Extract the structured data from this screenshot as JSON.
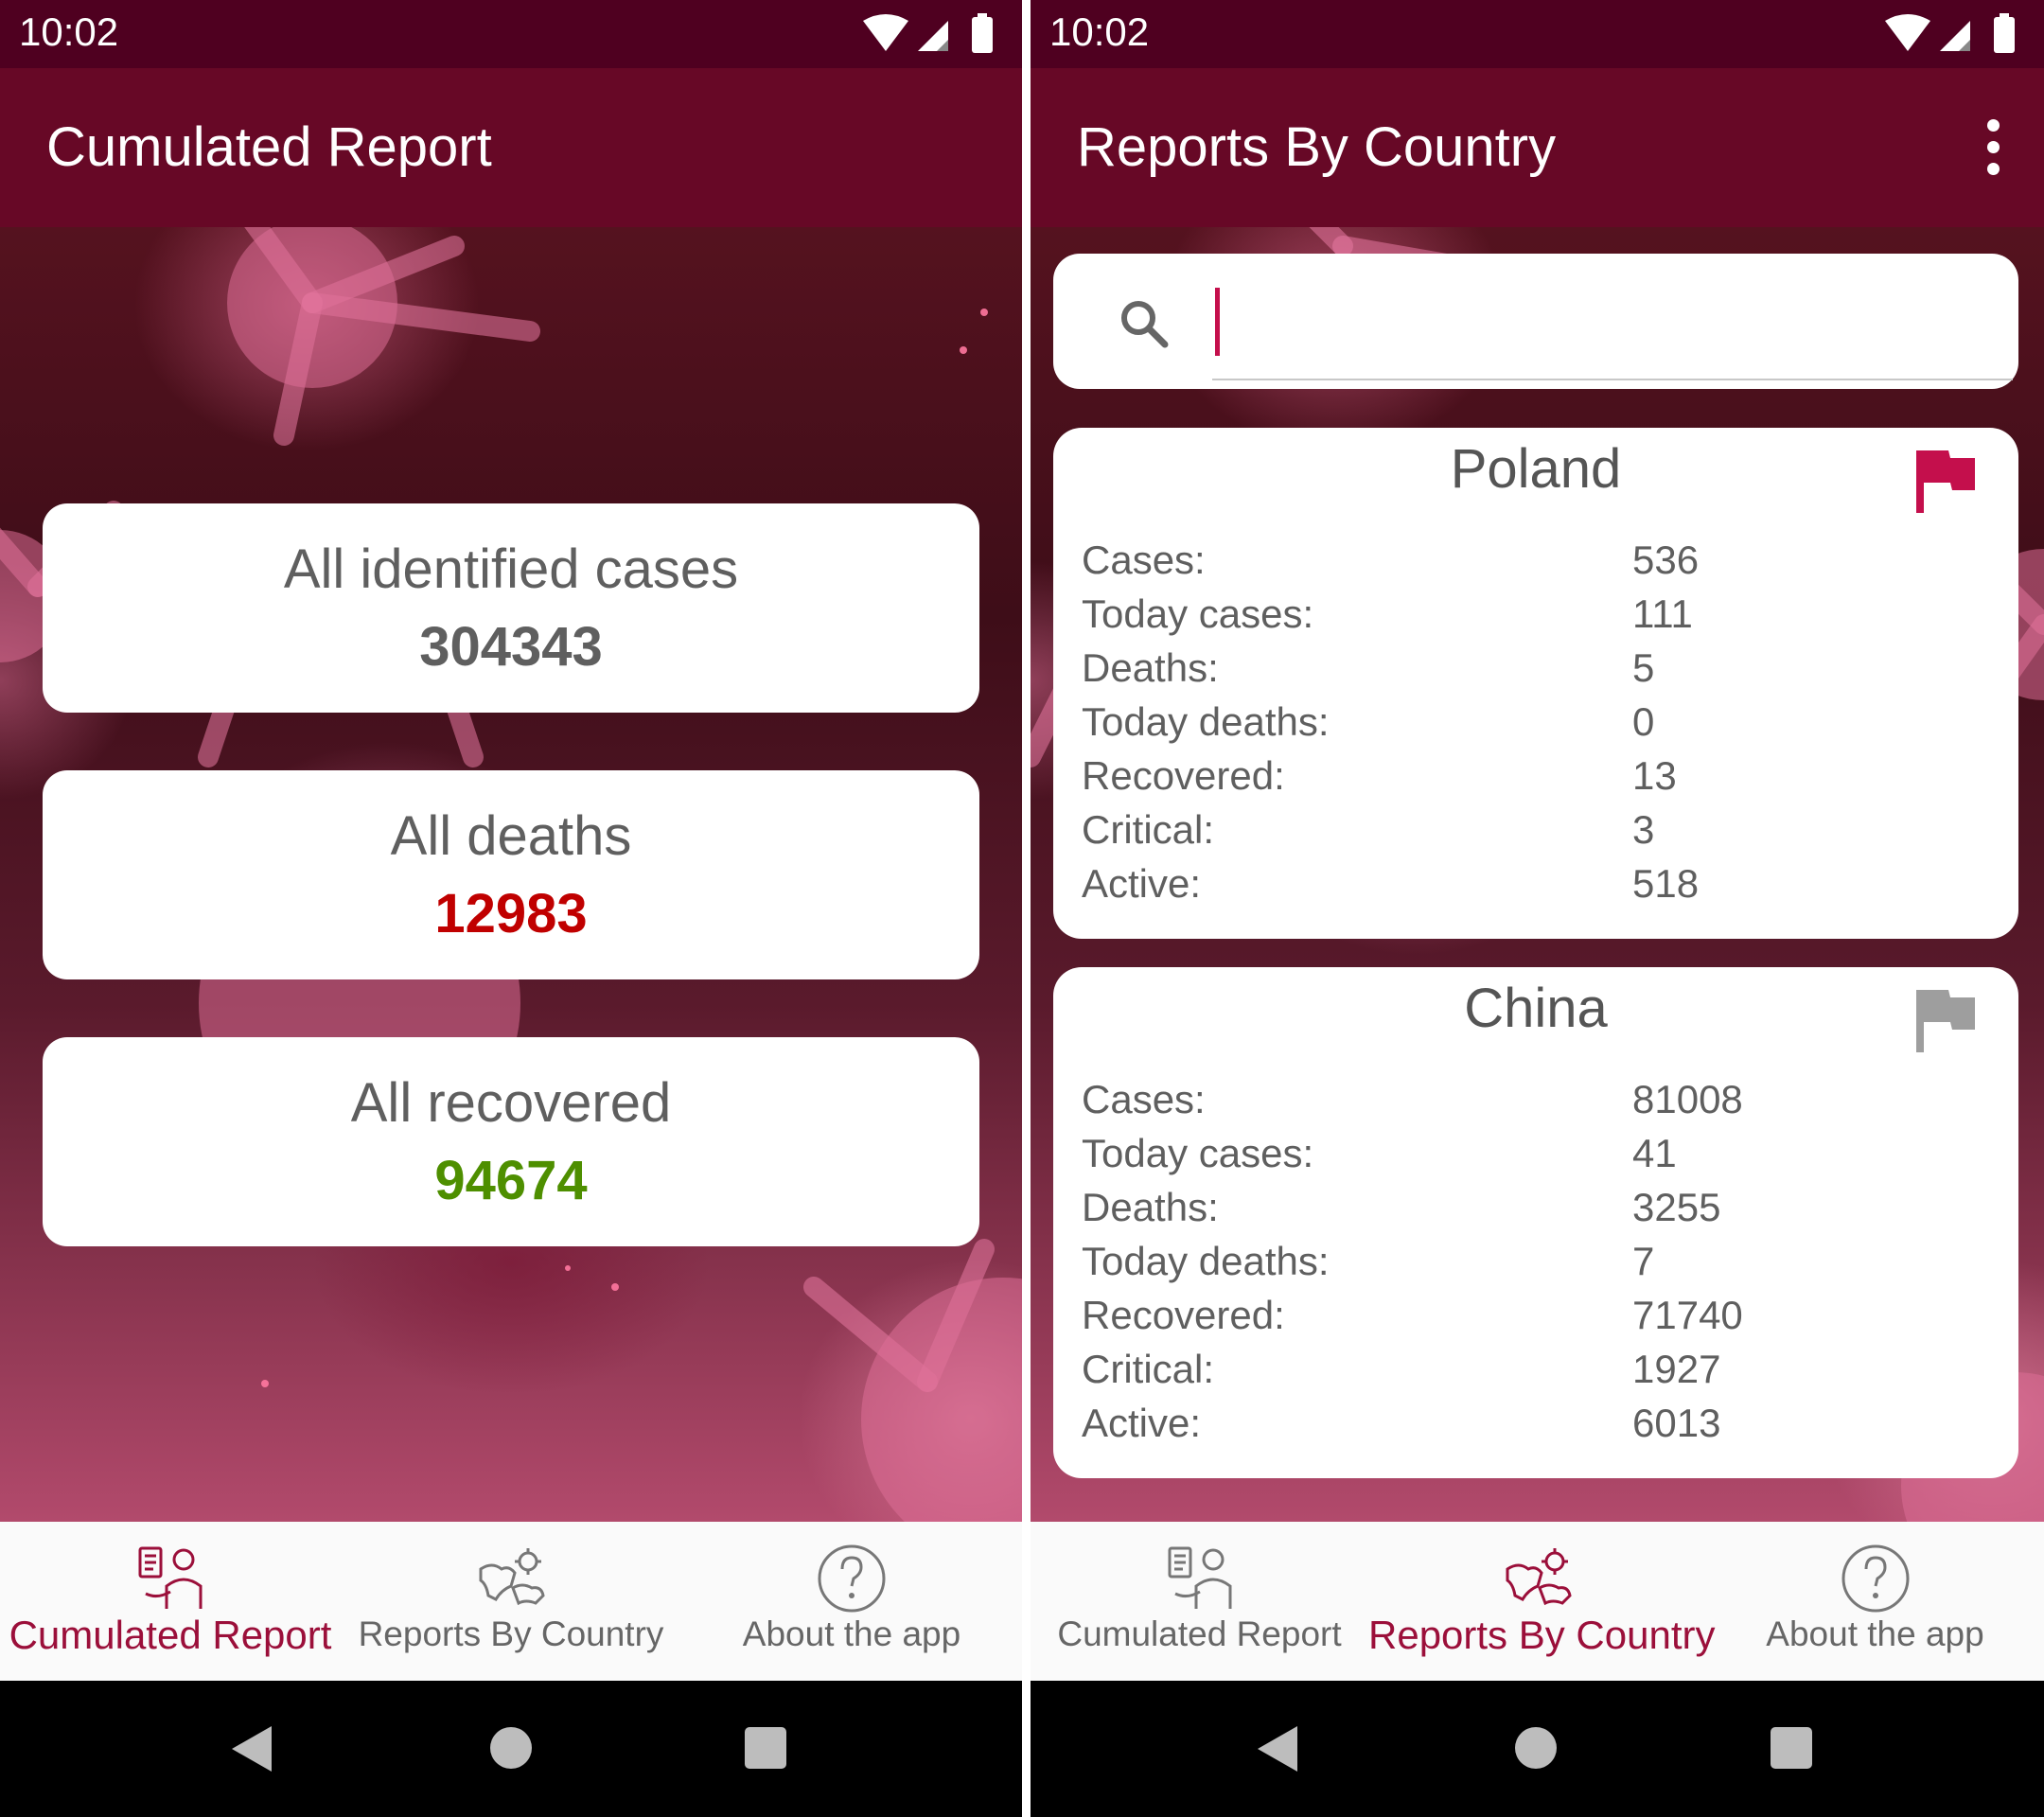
{
  "status_bar": {
    "time": "10:02"
  },
  "left_screen": {
    "title": "Cumulated Report",
    "cards": [
      {
        "label": "All identified cases",
        "value": "304343",
        "color": "#5f5f5f"
      },
      {
        "label": "All deaths",
        "value": "12983",
        "color": "#c00000"
      },
      {
        "label": "All recovered",
        "value": "94674",
        "color": "#4e8f00"
      }
    ]
  },
  "right_screen": {
    "title": "Reports By Country",
    "search": {
      "value": ""
    },
    "countries": [
      {
        "name": "Poland",
        "flag_color": "#c40f4c",
        "stats": [
          {
            "label": "Cases:",
            "value": "536"
          },
          {
            "label": "Today cases:",
            "value": "111"
          },
          {
            "label": "Deaths:",
            "value": "5"
          },
          {
            "label": "Today deaths:",
            "value": "0"
          },
          {
            "label": "Recovered:",
            "value": "13"
          },
          {
            "label": "Critical:",
            "value": "3"
          },
          {
            "label": "Active:",
            "value": "518"
          }
        ]
      },
      {
        "name": "China",
        "flag_color": "#9e9e9e",
        "stats": [
          {
            "label": "Cases:",
            "value": "81008"
          },
          {
            "label": "Today cases:",
            "value": "41"
          },
          {
            "label": "Deaths:",
            "value": "3255"
          },
          {
            "label": "Today deaths:",
            "value": "7"
          },
          {
            "label": "Recovered:",
            "value": "71740"
          },
          {
            "label": "Critical:",
            "value": "1927"
          },
          {
            "label": "Active:",
            "value": "6013"
          }
        ]
      }
    ]
  },
  "bottom_nav": {
    "items": [
      {
        "label": "Cumulated Report",
        "icon": "doctor-report-icon"
      },
      {
        "label": "Reports By Country",
        "icon": "world-map-virus-icon"
      },
      {
        "label": "About the app",
        "icon": "question-circle-icon"
      }
    ],
    "active_left": 0,
    "active_right": 1,
    "active_color": "#9b0f3a",
    "inactive_color": "#666666"
  },
  "theme": {
    "status_bar": "#4f0020",
    "app_bar": "#670826",
    "accent": "#c40f4c"
  }
}
